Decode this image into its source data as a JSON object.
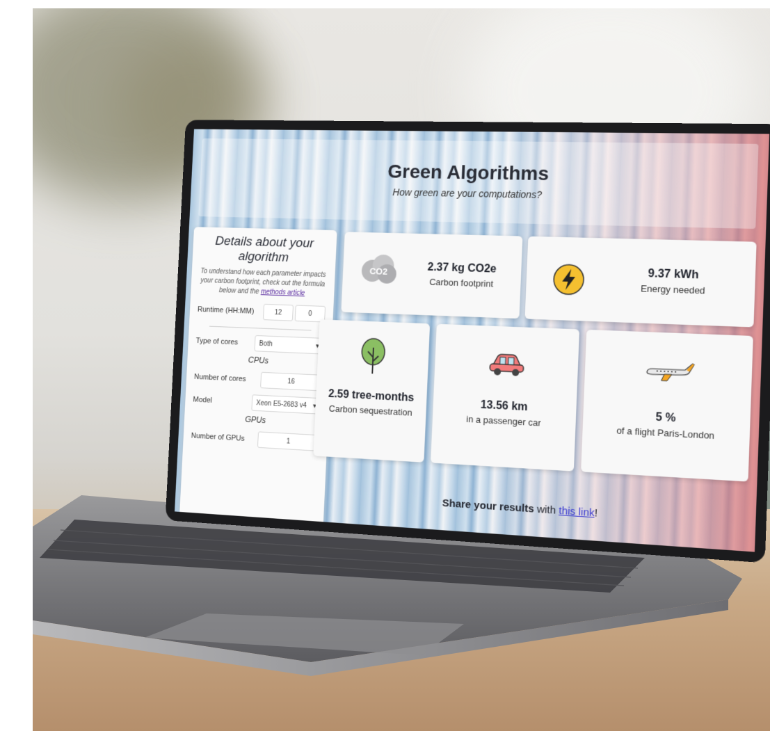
{
  "site": {
    "title": "Green Algorithms",
    "subtitle": "How green are your computations?"
  },
  "details": {
    "title": "Details about your algorithm",
    "intro_text": "To understand how each parameter impacts your carbon footprint, check out the formula below and the",
    "intro_link": "methods article",
    "runtime_label": "Runtime (HH:MM)",
    "runtime_hours": "12",
    "runtime_minutes": "0",
    "cores_type_label": "Type of cores",
    "cores_type_value": "Both",
    "cpus_heading": "CPUs",
    "num_cores_label": "Number of cores",
    "num_cores_value": "16",
    "model_label": "Model",
    "model_value": "Xeon E5-2683 v4",
    "gpus_heading": "GPUs",
    "num_gpus_label": "Number of GPUs",
    "num_gpus_value": "1"
  },
  "results": {
    "carbon_value": "2.37 kg CO2e",
    "carbon_label": "Carbon footprint",
    "energy_value": "9.37 kWh",
    "energy_label": "Energy needed",
    "trees_value": "2.59 tree-months",
    "trees_label": "Carbon sequestration",
    "car_value": "13.56 km",
    "car_label": "in a passenger car",
    "flight_value": "5 %",
    "flight_label": "of a flight Paris-London"
  },
  "share": {
    "prefix": "Share your results",
    "middle": "with",
    "link": "this link",
    "suffix": "!"
  },
  "icons": {
    "co2_text": "CO2"
  },
  "colors": {
    "bolt_circle": "#f5c030",
    "tree": "#8bbf63",
    "car": "#f27b7b",
    "flight_tail": "#f5a623"
  }
}
